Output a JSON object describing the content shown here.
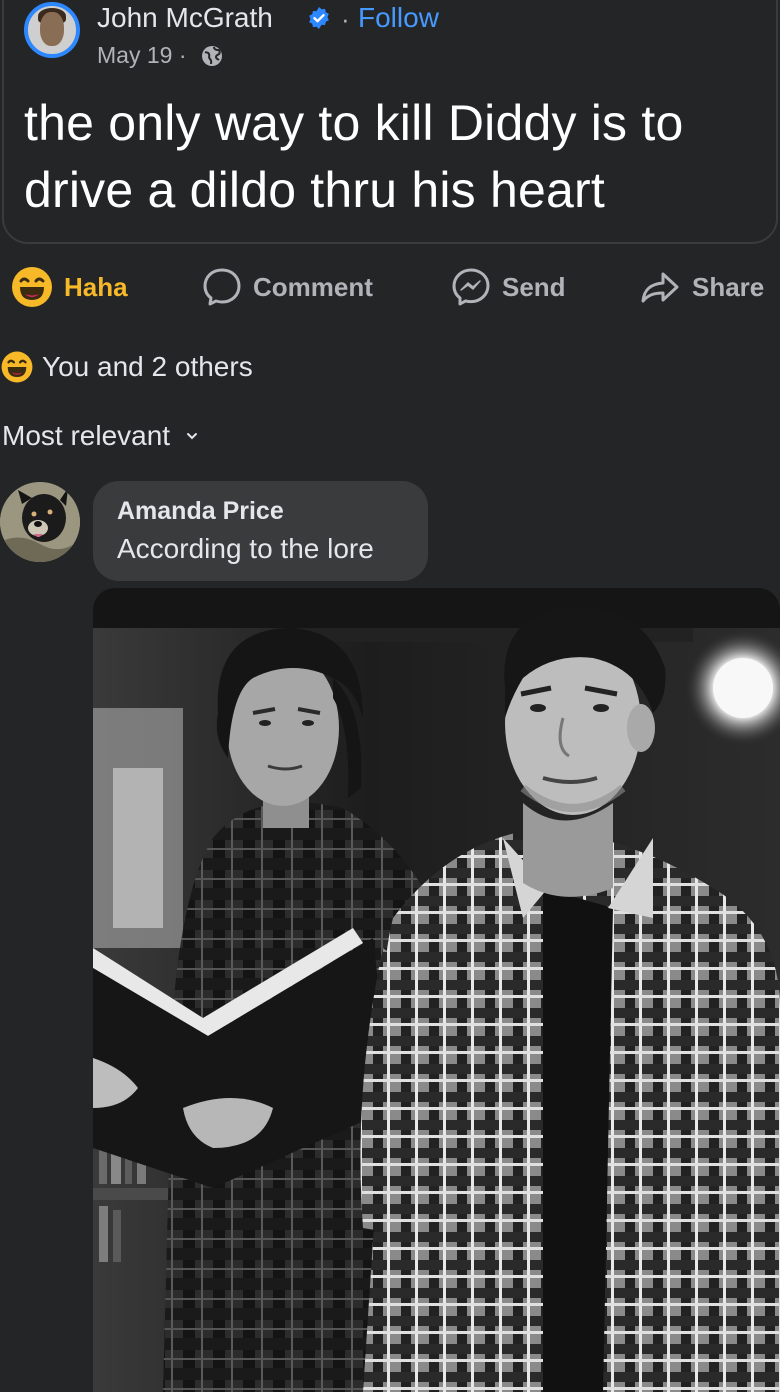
{
  "post": {
    "author_name": "John McGrath",
    "follow_label": "Follow",
    "date": "May 19 ·",
    "text": "the only way to kill Diddy is to drive a dildo thru his heart"
  },
  "actions": {
    "haha_label": "Haha",
    "comment_label": "Comment",
    "send_label": "Send",
    "share_label": "Share"
  },
  "reactions": {
    "summary": "You and 2 others"
  },
  "comments_sort": {
    "selected": "Most relevant"
  },
  "comment": {
    "author": "Amanda Price",
    "text": "According to the lore",
    "photo_icon": "photo-two-men-with-book"
  },
  "icons": {
    "verified": "verified-badge-icon",
    "globe": "globe-icon",
    "haha": "haha-emoji-icon",
    "comment": "speech-bubble-icon",
    "send": "messenger-icon",
    "share": "share-arrow-icon",
    "sort": "chevron-down-icon"
  },
  "colors": {
    "background": "#242526",
    "accent": "#4599ff",
    "haha": "#f7b928",
    "bubble": "#3a3b3c"
  }
}
